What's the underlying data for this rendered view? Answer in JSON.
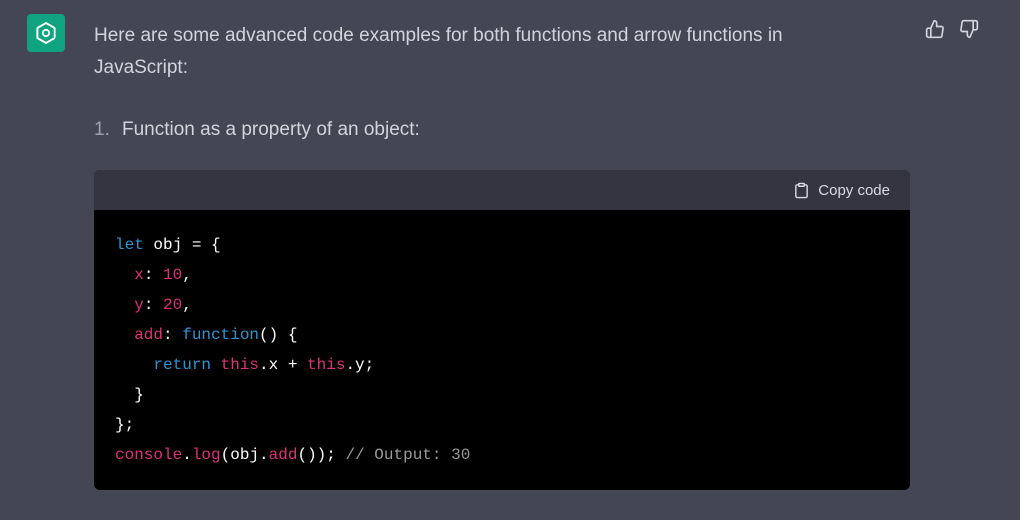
{
  "avatar": {
    "icon": "openai-logo-icon",
    "bg_color": "#10a37f"
  },
  "message": {
    "intro": "Here are some advanced code examples for both functions and arrow functions in JavaScript:",
    "list": [
      {
        "number": "1.",
        "text": "Function as a property of an object:"
      }
    ]
  },
  "feedback": {
    "thumbs_up_icon": "thumbs-up-icon",
    "thumbs_down_icon": "thumbs-down-icon"
  },
  "code_block": {
    "copy_label": "Copy code",
    "copy_icon": "clipboard-icon",
    "lines": [
      [
        {
          "t": "let",
          "c": "kw"
        },
        {
          "t": " obj = {",
          "c": "plain"
        }
      ],
      [
        {
          "t": "  ",
          "c": "plain"
        },
        {
          "t": "x",
          "c": "prop"
        },
        {
          "t": ": ",
          "c": "plain"
        },
        {
          "t": "10",
          "c": "num-lit"
        },
        {
          "t": ",",
          "c": "plain"
        }
      ],
      [
        {
          "t": "  ",
          "c": "plain"
        },
        {
          "t": "y",
          "c": "prop"
        },
        {
          "t": ": ",
          "c": "plain"
        },
        {
          "t": "20",
          "c": "num-lit"
        },
        {
          "t": ",",
          "c": "plain"
        }
      ],
      [
        {
          "t": "  ",
          "c": "plain"
        },
        {
          "t": "add",
          "c": "prop"
        },
        {
          "t": ": ",
          "c": "plain"
        },
        {
          "t": "function",
          "c": "kw"
        },
        {
          "t": "() {",
          "c": "plain"
        }
      ],
      [
        {
          "t": "    ",
          "c": "plain"
        },
        {
          "t": "return",
          "c": "kw"
        },
        {
          "t": " ",
          "c": "plain"
        },
        {
          "t": "this",
          "c": "prop"
        },
        {
          "t": ".x + ",
          "c": "plain"
        },
        {
          "t": "this",
          "c": "prop"
        },
        {
          "t": ".y;",
          "c": "plain"
        }
      ],
      [
        {
          "t": "  }",
          "c": "plain"
        }
      ],
      [
        {
          "t": "};",
          "c": "plain"
        }
      ],
      [
        {
          "t": "console",
          "c": "prop"
        },
        {
          "t": ".",
          "c": "plain"
        },
        {
          "t": "log",
          "c": "prop"
        },
        {
          "t": "(obj.",
          "c": "plain"
        },
        {
          "t": "add",
          "c": "prop"
        },
        {
          "t": "()); ",
          "c": "plain"
        },
        {
          "t": "// Output: 30",
          "c": "cmt"
        }
      ]
    ]
  }
}
